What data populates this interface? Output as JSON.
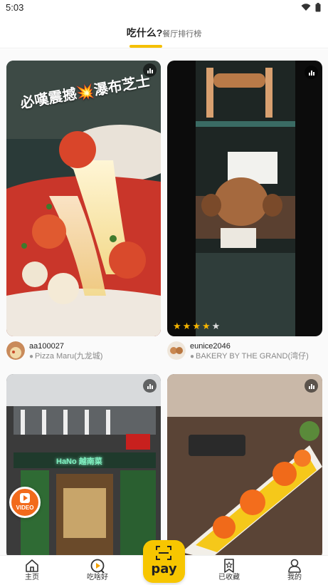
{
  "status_bar": {
    "time": "5:03"
  },
  "header": {
    "title": "吃什么?",
    "subtitle": "餐厅排行榜"
  },
  "feed": {
    "cards": [
      {
        "overlay_text": "必嘆震撼💥瀑布芝士",
        "username": "aa100027",
        "location": "Pizza Maru(九龙城)"
      },
      {
        "username": "eunice2046",
        "location": "BAKERY BY THE GRAND(湾仔)",
        "rating": 4,
        "rating_max": 5
      },
      {
        "username": "",
        "location": ""
      },
      {
        "username": "",
        "location": ""
      }
    ],
    "neon_sign": "HaNo 越南菜"
  },
  "video_fab": {
    "label": "VIDEO"
  },
  "pay_button": {
    "label": "pay"
  },
  "bottom_nav": {
    "items": [
      {
        "label": "主页",
        "icon": "home-icon"
      },
      {
        "label": "吃啥好",
        "icon": "play-circle-icon"
      },
      {
        "label": "已收藏",
        "icon": "bookmark-star-icon"
      },
      {
        "label": "我的",
        "icon": "user-icon"
      }
    ]
  },
  "colors": {
    "accent": "#f5c000",
    "fab": "#f26a1b",
    "star": "#f5b400"
  }
}
